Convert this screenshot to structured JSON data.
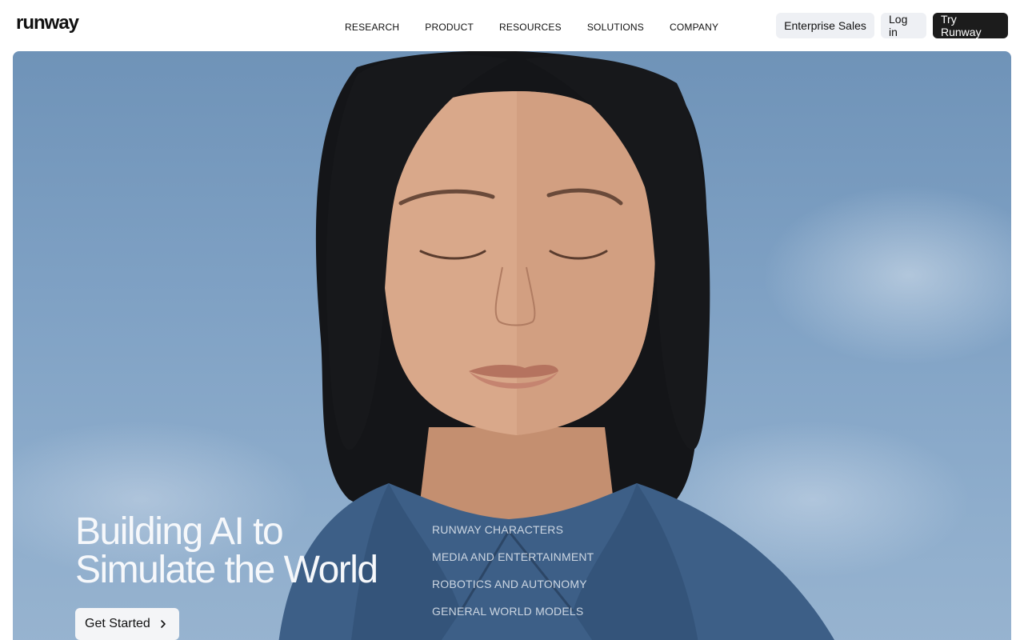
{
  "brand": {
    "logo_text": "runway"
  },
  "nav": {
    "items": [
      {
        "label": "RESEARCH"
      },
      {
        "label": "PRODUCT"
      },
      {
        "label": "RESOURCES"
      },
      {
        "label": "SOLUTIONS"
      },
      {
        "label": "COMPANY"
      }
    ]
  },
  "header_actions": {
    "enterprise_label": "Enterprise Sales",
    "login_label": "Log in",
    "try_label": "Try Runway"
  },
  "hero": {
    "headline_line1": "Building AI to",
    "headline_line2": "Simulate the World",
    "cta_label": "Get Started",
    "cta_icon": "chevron-right-icon",
    "solutions": [
      {
        "label": "RUNWAY CHARACTERS"
      },
      {
        "label": "MEDIA AND ENTERTAINMENT"
      },
      {
        "label": "ROBOTICS AND AUTONOMY"
      },
      {
        "label": "GENERAL WORLD MODELS"
      }
    ]
  },
  "colors": {
    "primary_button": "#1c1c1c",
    "secondary_button": "#eef0f4",
    "sky": "#7fa1c4"
  }
}
